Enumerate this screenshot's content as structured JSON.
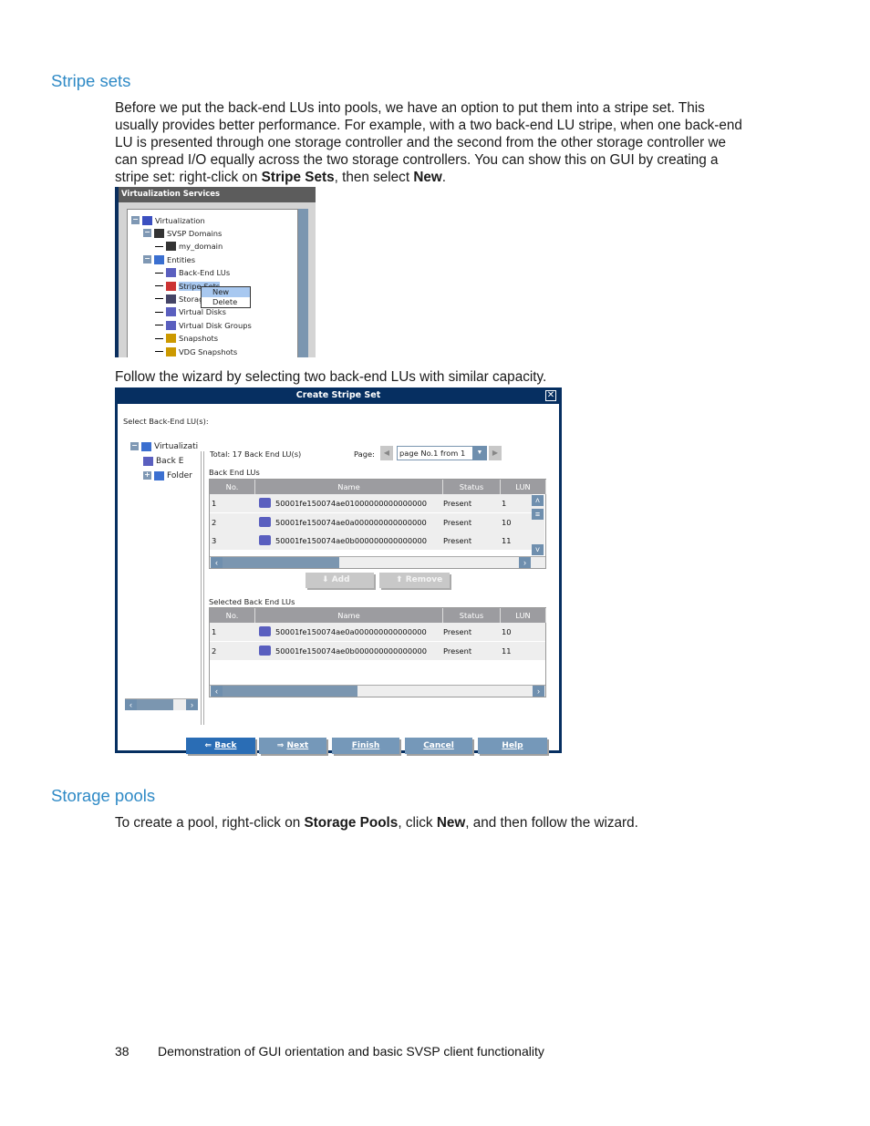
{
  "section1": {
    "heading": "Stripe sets",
    "paragraph": [
      "Before we put the back-end LUs into pools, we have an option to put them into a stripe set. This usually provides better performance. For example, with a two back-end LU stripe, when one back-end LU is presented through one storage controller and the second from the other storage controller we can spread I/O equally across the two storage controllers. You can show this on GUI by creating a stripe set: right-click on ",
      "Stripe Sets",
      ", then select ",
      "New",
      "."
    ],
    "follow": "Follow the wizard by selecting two back-end LUs with similar capacity."
  },
  "shot1": {
    "title": "Virtualization Services",
    "tree": [
      "Virtualization",
      "SVSP Domains",
      "my_domain",
      "Entities",
      "Back-End LUs",
      "Stripe Sets",
      "Storage Pools",
      "Virtual Disks",
      "Virtual Disk Groups",
      "Snapshots",
      "VDG Snapshots"
    ],
    "menu": [
      "New",
      "Delete"
    ]
  },
  "dialog": {
    "title": "Create Stripe Set",
    "close": "✕",
    "select_label": "Select Back-End LU(s):",
    "tree": [
      "Virtualizati",
      "Back E",
      "Folder"
    ],
    "total": "Total: 17 Back End LU(s)",
    "page_label": "Page:",
    "page_value": "page No.1  from 1",
    "table1_label": "Back End LUs",
    "table2_label": "Selected Back End LUs",
    "columns": [
      "No.",
      "Name",
      "Status",
      "LUN"
    ],
    "table1": [
      [
        "1",
        "50001fe150074ae01000000000000000",
        "Present",
        "1"
      ],
      [
        "2",
        "50001fe150074ae0a000000000000000",
        "Present",
        "10"
      ],
      [
        "3",
        "50001fe150074ae0b000000000000000",
        "Present",
        "11"
      ]
    ],
    "table2": [
      [
        "1",
        "50001fe150074ae0a000000000000000",
        "Present",
        "10"
      ],
      [
        "2",
        "50001fe150074ae0b000000000000000",
        "Present",
        "11"
      ]
    ],
    "add": "Add",
    "remove": "Remove",
    "buttons": [
      "Back",
      "Next",
      "Finish",
      "Cancel",
      "Help"
    ]
  },
  "section2": {
    "heading": "Storage pools",
    "paragraph": [
      "To create a pool, right-click on ",
      "Storage Pools",
      ", click ",
      "New",
      ", and then follow the wizard."
    ]
  },
  "footer": {
    "page": "38",
    "text": "Demonstration of GUI orientation and basic SVSP client functionality"
  },
  "colors": {
    "heading": "#2f8ac6",
    "dialog_frame": "#062f61",
    "button": "#7598b9",
    "back_button": "#2a6db5"
  }
}
